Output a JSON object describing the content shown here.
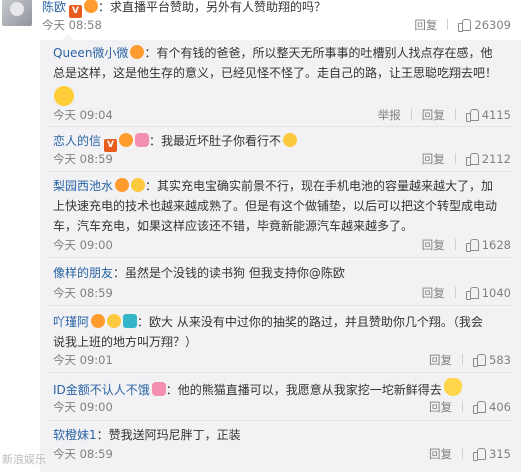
{
  "main": {
    "username": "陈欧",
    "text": "：求直播平台赞助，另外有人赞助翔的吗？",
    "time": "今天 08:58",
    "reply": "回复",
    "likes": "26309"
  },
  "replies": [
    {
      "username": "Queen微小微",
      "lines": [
        "：有个有钱的爸爸，所以整天无所事事的吐槽别人找点存在感，他",
        "总是这样，这是他生存的意义，已经见怪不怪了。走自己的路，让王思聪吃翔去吧！"
      ],
      "time": "今天 09:04",
      "report": "举报",
      "reply": "回复",
      "likes": "4115"
    },
    {
      "username": "恋人的信",
      "lines": [
        "：我最近坏肚子你看行不"
      ],
      "time": "今天 08:59",
      "reply": "回复",
      "likes": "2112"
    },
    {
      "username": "梨园西池水",
      "lines": [
        "：其实充电宝确实前景不行，现在手机电池的容量越来越大了，加",
        "上快速充电的技术也越来越成熟了。但是有这个做铺垫，以后可以把这个转型成电动",
        "车，汽车充电，如果这样应该还不错，毕竟新能源汽车越来越多了。"
      ],
      "time": "今天 09:00",
      "reply": "回复",
      "likes": "1628"
    },
    {
      "username": "像样的朋友",
      "lines": [
        "：虽然是个没钱的读书狗 但我支持你@陈欧"
      ],
      "time": "今天 08:59",
      "reply": "回复",
      "likes": "1040"
    },
    {
      "username": "吖瑾阿",
      "lines": [
        "：欧大 从来没有中过你的抽奖的路过，并且赞助你几个翔。（我会",
        "说我上班的地方叫万翔？）"
      ],
      "time": "今天 09:01",
      "reply": "回复",
      "likes": "583"
    },
    {
      "username": "ID金额不认人不饿",
      "lines": [
        "：他的熊猫直播可以，我愿意从我家挖一坨新鲜得去"
      ],
      "time": "今天 09:00",
      "reply": "回复",
      "likes": "406"
    },
    {
      "username": "软橙妹1",
      "lines": [
        "：赞我送阿玛尼胖丁，正装"
      ],
      "time": "今天 08:59",
      "reply": "回复",
      "likes": "315"
    }
  ],
  "watermark": "新浪娱乐",
  "icons": {
    "avatar": "user-avatar",
    "thumb": "thumb-up-icon",
    "verified": "verified-v-icon"
  },
  "colors": {
    "username": "#2a63a4",
    "reply_bg": "#f2f2f5",
    "meta": "#808080"
  }
}
